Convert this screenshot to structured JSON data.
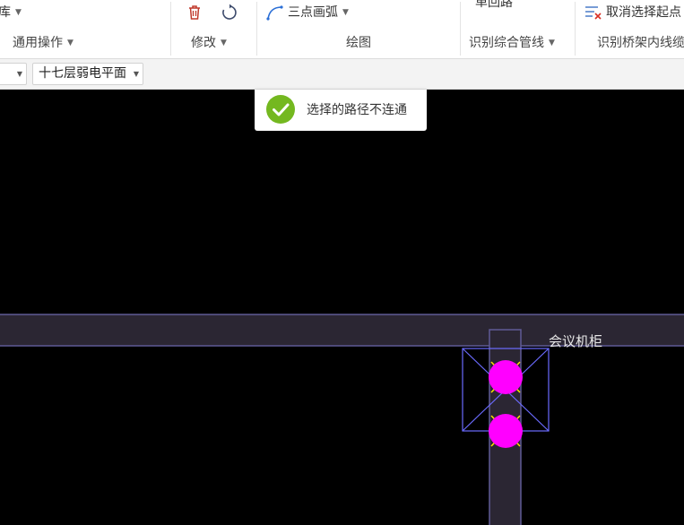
{
  "ribbon": {
    "groups": {
      "general": {
        "top_item": "库",
        "label": "通用操作"
      },
      "modify": {
        "label": "修改",
        "delete_icon": "trash-icon",
        "rotate_icon": "rotate-icon"
      },
      "draw": {
        "arc_label": "三点画弧",
        "arc_icon": "arc-icon",
        "label": "绘图"
      },
      "identify": {
        "top_item": "单回路",
        "label": "识别综合管线"
      },
      "bridge": {
        "cancel_label": "取消选择起点",
        "cancel_icon": "cancel-select-icon",
        "label": "识别桥架内线缆"
      }
    }
  },
  "subbar": {
    "left_combo_value": "",
    "floor_combo_value": "十七层弱电平面"
  },
  "canvas": {
    "room_label": "会议机柜"
  },
  "toast": {
    "message": "选择的路径不连通",
    "icon": "check-circle-icon"
  },
  "colors": {
    "toast_success": "#74b820",
    "cable_tray_fill": "#2b2633",
    "cable_tray_edge": "#5f5a96",
    "device_magenta": "#ff00ff",
    "selection_blue": "#6b6bff",
    "marker_yellow": "#ffe600"
  }
}
